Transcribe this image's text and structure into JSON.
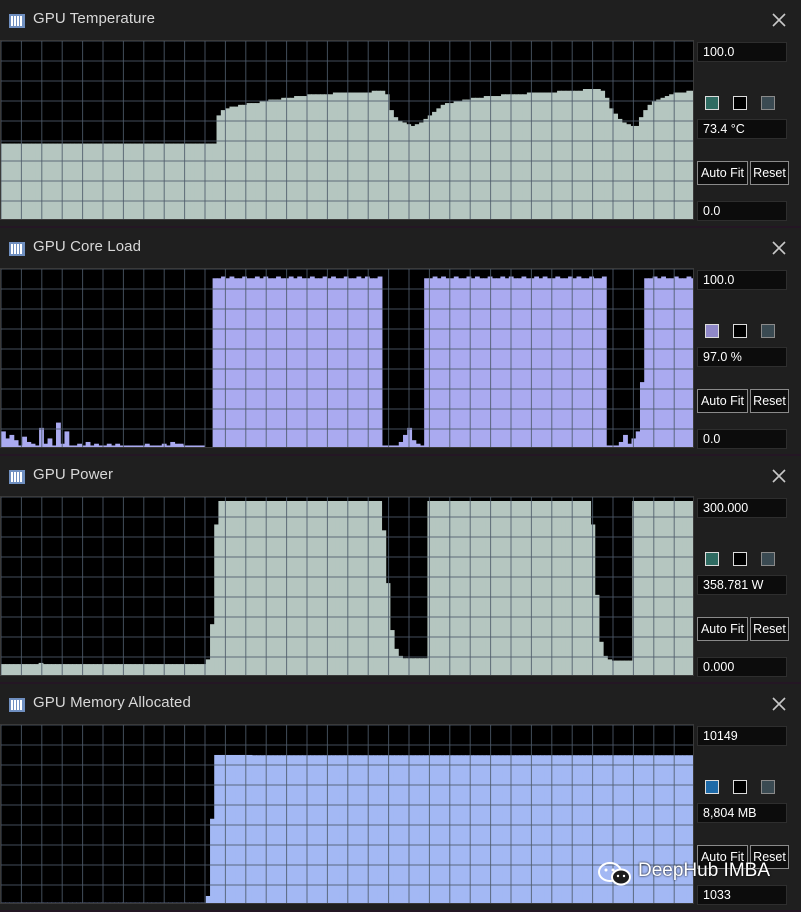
{
  "panels": [
    {
      "title": "GPU Temperature",
      "max_label": "100.0",
      "current_label": "73.4 °C",
      "min_label": "0.0",
      "auto_fit_label": "Auto Fit",
      "reset_label": "Reset",
      "color": "#b5c6c0",
      "swatch_color": "#2f6b62",
      "axis_max": 100,
      "axis_min": 0,
      "values": [
        44,
        44,
        44,
        44,
        44,
        44,
        44,
        44,
        44,
        44,
        44,
        44,
        44,
        44,
        44,
        44,
        44,
        44,
        44,
        44,
        44,
        44,
        44,
        44,
        44,
        44,
        44,
        44,
        44,
        44,
        44,
        44,
        44,
        44,
        44,
        44,
        44,
        44,
        44,
        44,
        44,
        44,
        44,
        44,
        44,
        44,
        44,
        44,
        44,
        44,
        60,
        63,
        64,
        65,
        65,
        66,
        66,
        67,
        67,
        67,
        68,
        68,
        69,
        69,
        69,
        70,
        70,
        70,
        71,
        71,
        71,
        72,
        72,
        72,
        72,
        72,
        72,
        73,
        73,
        73,
        73,
        73,
        73,
        73,
        73,
        73,
        74,
        74,
        74,
        72,
        63,
        59,
        57,
        56,
        55,
        54,
        55,
        56,
        58,
        60,
        62,
        64,
        66,
        67,
        67,
        68,
        68,
        69,
        69,
        70,
        70,
        70,
        71,
        71,
        71,
        71,
        72,
        72,
        72,
        72,
        72,
        72,
        73,
        73,
        73,
        73,
        73,
        73,
        73,
        74,
        74,
        74,
        74,
        74,
        74,
        75,
        75,
        75,
        75,
        74,
        70,
        64,
        61,
        58,
        56,
        55,
        54,
        54,
        59,
        63,
        66,
        68,
        69,
        70,
        71,
        72,
        73,
        73,
        73,
        74,
        74
      ]
    },
    {
      "title": "GPU Core Load",
      "max_label": "100.0",
      "current_label": "97.0 %",
      "min_label": "0.0",
      "auto_fit_label": "Auto Fit",
      "reset_label": "Reset",
      "color": "#aaaaf0",
      "swatch_color": "#8f88c8",
      "axis_max": 100,
      "axis_min": 0,
      "values": [
        10,
        6,
        8,
        5,
        2,
        7,
        4,
        3,
        2,
        12,
        3,
        6,
        2,
        15,
        3,
        10,
        2,
        2,
        3,
        2,
        4,
        2,
        3,
        2,
        2,
        3,
        2,
        3,
        2,
        2,
        2,
        2,
        2,
        2,
        3,
        2,
        2,
        2,
        3,
        2,
        4,
        3,
        3,
        2,
        2,
        2,
        2,
        2,
        1,
        1,
        97,
        97,
        98,
        97,
        98,
        97,
        97,
        98,
        97,
        97,
        98,
        97,
        98,
        97,
        97,
        98,
        97,
        97,
        98,
        97,
        98,
        97,
        97,
        98,
        97,
        97,
        98,
        97,
        98,
        97,
        97,
        98,
        97,
        97,
        98,
        97,
        98,
        97,
        97,
        98,
        2,
        2,
        2,
        2,
        4,
        8,
        12,
        5,
        3,
        2,
        97,
        97,
        98,
        97,
        98,
        97,
        97,
        98,
        97,
        97,
        98,
        97,
        98,
        97,
        97,
        98,
        97,
        97,
        98,
        97,
        98,
        97,
        97,
        98,
        97,
        97,
        98,
        97,
        98,
        97,
        97,
        98,
        97,
        97,
        98,
        97,
        98,
        97,
        97,
        98,
        97,
        97,
        98,
        2,
        2,
        2,
        4,
        8,
        3,
        6,
        10,
        38,
        97,
        97,
        98,
        97,
        98,
        97,
        97,
        98,
        97,
        97,
        98,
        97
      ]
    },
    {
      "title": "GPU Power",
      "max_label": "300.000",
      "current_label": "358.781 W",
      "min_label": "0.000",
      "auto_fit_label": "Auto Fit",
      "reset_label": "Reset",
      "color": "#b5c6c0",
      "swatch_color": "#2f6b62",
      "axis_max": 300,
      "axis_min": 0,
      "values": [
        22,
        22,
        22,
        22,
        22,
        22,
        22,
        22,
        22,
        24,
        22,
        22,
        22,
        22,
        22,
        22,
        22,
        22,
        22,
        22,
        22,
        22,
        22,
        22,
        22,
        22,
        22,
        22,
        22,
        22,
        22,
        22,
        22,
        22,
        22,
        22,
        22,
        22,
        22,
        22,
        22,
        22,
        22,
        22,
        22,
        22,
        22,
        22,
        22,
        30,
        90,
        260,
        300,
        300,
        300,
        300,
        300,
        300,
        300,
        300,
        300,
        300,
        300,
        300,
        300,
        300,
        300,
        300,
        300,
        300,
        300,
        300,
        300,
        300,
        300,
        300,
        300,
        300,
        300,
        300,
        300,
        300,
        300,
        300,
        300,
        300,
        300,
        300,
        300,
        300,
        300,
        250,
        160,
        80,
        48,
        36,
        32,
        32,
        32,
        32,
        32,
        32,
        300,
        300,
        300,
        300,
        300,
        300,
        300,
        300,
        300,
        300,
        300,
        300,
        300,
        300,
        300,
        300,
        300,
        300,
        300,
        300,
        300,
        300,
        300,
        300,
        300,
        300,
        300,
        300,
        300,
        300,
        300,
        300,
        300,
        300,
        300,
        300,
        300,
        300,
        300,
        260,
        140,
        60,
        36,
        30,
        28,
        28,
        28,
        28,
        28,
        300,
        300,
        300,
        300,
        300,
        300,
        300,
        300,
        300,
        300,
        300,
        300,
        300,
        300,
        300
      ]
    },
    {
      "title": "GPU Memory Allocated",
      "max_label": "10149",
      "current_label": "8,804 MB",
      "min_label": "1033",
      "auto_fit_label": "Auto Fit",
      "reset_label": "Reset",
      "color": "#a3b8f4",
      "swatch_color": "#1e6aa8",
      "axis_max": 10149,
      "axis_min": 1033,
      "values": [
        1150,
        1150,
        1150,
        1150,
        1150,
        1150,
        1150,
        1150,
        1150,
        1150,
        1150,
        1150,
        1150,
        1150,
        1150,
        1150,
        1150,
        1150,
        1150,
        1150,
        1150,
        1150,
        1150,
        1150,
        1150,
        1150,
        1150,
        1150,
        1150,
        1150,
        1150,
        1150,
        1150,
        1150,
        1150,
        1150,
        1150,
        1150,
        1150,
        1150,
        1150,
        1150,
        1150,
        1150,
        1150,
        1150,
        1150,
        1150,
        1150,
        1500,
        5500,
        8804,
        8804,
        8804,
        8804,
        8804,
        8804,
        8804,
        8804,
        8804,
        8790,
        8790,
        8790,
        8790,
        8790,
        8790,
        8790,
        8790,
        8790,
        8790,
        8790,
        8790,
        8790,
        8790,
        8790,
        8790,
        8790,
        8790,
        8790,
        8790,
        8790,
        8790,
        8790,
        8790,
        8790,
        8790,
        8790,
        8790,
        8790,
        8790,
        8790,
        8790,
        8790,
        8790,
        8790,
        8790,
        8790,
        8790,
        8790,
        8790,
        8790,
        8790,
        8790,
        8790,
        8790,
        8790,
        8790,
        8790,
        8790,
        8790,
        8790,
        8790,
        8790,
        8790,
        8790,
        8790,
        8790,
        8790,
        8790,
        8790,
        8790,
        8790,
        8790,
        8790,
        8790,
        8790,
        8790,
        8790,
        8790,
        8790,
        8790,
        8790,
        8790,
        8790,
        8790,
        8790,
        8790,
        8790,
        8790,
        8790,
        8790,
        8790,
        8790,
        8790,
        8790,
        8790,
        8790,
        8790,
        8790,
        8790,
        8790,
        8790,
        8790,
        8790,
        8790,
        8790,
        8790,
        8790,
        8790,
        8790,
        8790,
        8790,
        8790,
        8790,
        8790,
        8790
      ]
    }
  ],
  "watermark": {
    "text": "DeepHub IMBA"
  }
}
